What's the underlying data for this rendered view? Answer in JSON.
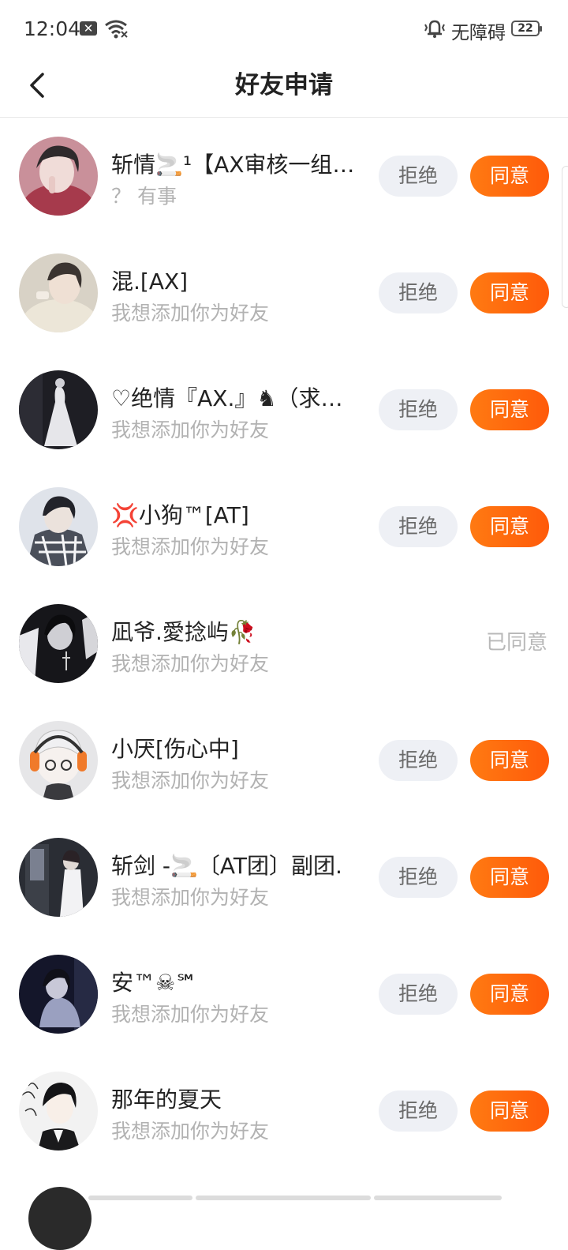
{
  "status_bar": {
    "time": "12:04",
    "x_badge": "✕",
    "accessibility": "无障碍",
    "battery": "22"
  },
  "nav": {
    "title": "好友申请"
  },
  "buttons": {
    "reject": "拒绝",
    "accept": "同意",
    "accepted": "已同意"
  },
  "requests": [
    {
      "name": "斩情🚬¹【AX审核一组…",
      "message": "？ 有事",
      "status": "pending"
    },
    {
      "name": "混.[AX]",
      "message": "我想添加你为好友",
      "status": "pending"
    },
    {
      "name": "♡绝情『AX.』♞（求送…",
      "message": "我想添加你为好友",
      "status": "pending"
    },
    {
      "name": "💢小狗™[AT]",
      "message": "我想添加你为好友",
      "status": "pending"
    },
    {
      "name": "凪爷.愛捻屿🥀",
      "message": "我想添加你为好友",
      "status": "accepted"
    },
    {
      "name": "小厌[伤心中]",
      "message": "我想添加你为好友",
      "status": "pending"
    },
    {
      "name": "斩剑 -🚬〔AT团〕副团.",
      "message": "我想添加你为好友",
      "status": "pending"
    },
    {
      "name": "安™☠℠",
      "message": "我想添加你为好友",
      "status": "pending"
    },
    {
      "name": "那年的夏天",
      "message": "我想添加你为好友",
      "status": "pending"
    }
  ],
  "colors": {
    "accent": "#ff6a10",
    "reject_bg": "#eef0f5",
    "muted": "#b2b2b2"
  }
}
